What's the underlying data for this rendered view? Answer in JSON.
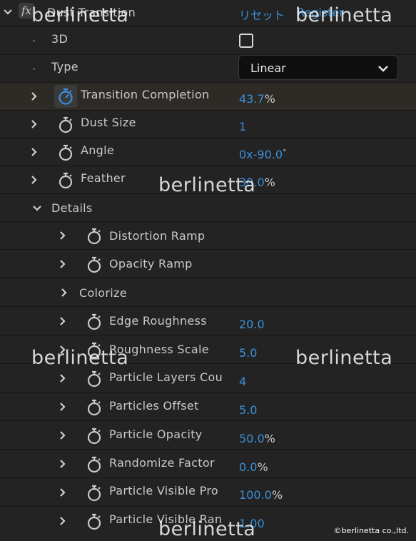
{
  "effect": {
    "name": "Dust Transition",
    "reset_label": "リセット",
    "register_label": "Register",
    "fx_label": "fx"
  },
  "props": {
    "p3d": {
      "label": "3D",
      "checked": false
    },
    "type": {
      "label": "Type",
      "value": "Linear"
    },
    "completion": {
      "label": "Transition Completion",
      "value": "43.7",
      "unit": "%"
    },
    "dust_size": {
      "label": "Dust Size",
      "value": "1"
    },
    "angle": {
      "label": "Angle",
      "value": "0x-90.0",
      "unit": "°"
    },
    "feather": {
      "label": "Feather",
      "value": "30.0",
      "unit": "%"
    },
    "details": {
      "label": "Details"
    },
    "distortion_ramp": {
      "label": "Distortion Ramp"
    },
    "opacity_ramp": {
      "label": "Opacity Ramp"
    },
    "colorize": {
      "label": "Colorize"
    },
    "edge_roughness": {
      "label": "Edge Roughness",
      "value": "20.0"
    },
    "roughness_scale": {
      "label": "Roughness Scale",
      "value": "5.0"
    },
    "particle_layers": {
      "label": "Particle Layers Cou",
      "value": "4"
    },
    "particles_offset": {
      "label": "Particles Offset",
      "value": "5.0"
    },
    "particle_opacity": {
      "label": "Particle Opacity",
      "value": "50.0",
      "unit": "%"
    },
    "randomize_factor": {
      "label": "Randomize Factor",
      "value": "0.0",
      "unit": "%"
    },
    "particle_visible_pro": {
      "label": "Particle Visible Pro",
      "value": "100.0",
      "unit": "%"
    },
    "particle_visible_ran": {
      "label": "Particle Visible Ran",
      "value": "1.00"
    }
  },
  "watermarks": {
    "text": "berlinetta",
    "copyright": "©berlinetta co.,ltd."
  },
  "colors": {
    "accent": "#3b8fd9",
    "background": "#232323",
    "highlight_row": "#2e2a25"
  }
}
